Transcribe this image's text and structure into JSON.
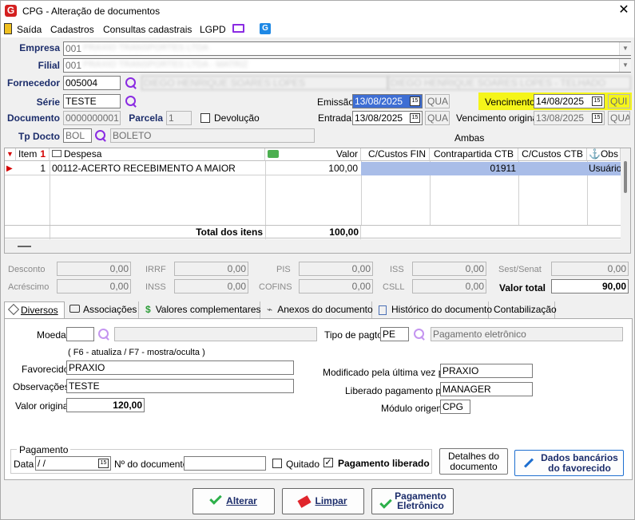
{
  "window": {
    "title": "CPG - Alteração de documentos",
    "app_logo": "G"
  },
  "menu": {
    "items": [
      "Saída",
      "Cadastros",
      "Consultas cadastrais",
      "LGPD"
    ]
  },
  "header": {
    "empresa": {
      "label": "Empresa",
      "code": "001",
      "name": "PRAXIO TRANSPORTES LTDA"
    },
    "filial": {
      "label": "Filial",
      "code": "001",
      "name": "PRAXIO TRANSPORTES LTDA - MATRIZ"
    },
    "fornecedor": {
      "label": "Fornecedor",
      "code": "005004",
      "name": "DIEGO HENRIQUE SOARES LOPES",
      "name2": "DIEGO HENRIQUE SOARES LOPES - TELHADO"
    },
    "serie": {
      "label": "Série",
      "value": "TESTE"
    },
    "emissao": {
      "label": "Emissão",
      "date": "13/08/2025",
      "day": "QUA"
    },
    "vencimento": {
      "label": "Vencimento",
      "date": "14/08/2025",
      "day": "QUI"
    },
    "documento": {
      "label": "Documento",
      "value": "0000000001"
    },
    "parcela": {
      "label": "Parcela",
      "value": "1"
    },
    "devolucao": {
      "label": "Devolução",
      "checked": false
    },
    "entrada": {
      "label": "Entrada",
      "date": "13/08/2025",
      "day": "QUA"
    },
    "venc_original": {
      "label": "Vencimento original",
      "date": "13/08/2025",
      "day": "QUA"
    },
    "tp_docto": {
      "label": "Tp Docto",
      "code": "BOL",
      "name": "BOLETO"
    },
    "ambas": "Ambas"
  },
  "grid": {
    "columns": [
      "Item",
      "Despesa",
      "Valor",
      "C/Custos FIN",
      "Contrapartida CTB",
      "C/Custos CTB",
      "Obs"
    ],
    "rows": [
      {
        "item": "1",
        "despesa": "00112-ACERTO RECEBIMENTO A MAIOR",
        "valor": "100,00",
        "cc_fin": "",
        "contrapartida": "01911",
        "cc_ctb": "",
        "obs": "Usuário"
      }
    ],
    "total_label": "Total dos itens",
    "total_value": "100,00"
  },
  "totals": {
    "desconto": {
      "label": "Desconto",
      "value": "0,00"
    },
    "irrf": {
      "label": "IRRF",
      "value": "0,00"
    },
    "pis": {
      "label": "PIS",
      "value": "0,00"
    },
    "iss": {
      "label": "ISS",
      "value": "0,00"
    },
    "sest": {
      "label": "Sest/Senat",
      "value": "0,00"
    },
    "acrescimo": {
      "label": "Acréscimo",
      "value": "0,00"
    },
    "inss": {
      "label": "INSS",
      "value": "0,00"
    },
    "cofins": {
      "label": "COFINS",
      "value": "0,00"
    },
    "csll": {
      "label": "CSLL",
      "value": "0,00"
    },
    "valor_total": {
      "label": "Valor total",
      "value": "90,00"
    }
  },
  "tabs": [
    "Diversos",
    "Associações",
    "Valores complementares",
    "Anexos do documento",
    "Histórico do documento",
    "Contabilização"
  ],
  "diversos": {
    "moeda": {
      "label": "Moeda",
      "value": ""
    },
    "tipo_pagto": {
      "label": "Tipo de pagto",
      "code": "PE",
      "name": "Pagamento eletrônico"
    },
    "hint": "( F6 - atualiza / F7 - mostra/oculta )",
    "favorecido": {
      "label": "Favorecido",
      "value": "PRAXIO"
    },
    "observacoes": {
      "label": "Observações",
      "value": "TESTE"
    },
    "valor_original": {
      "label": "Valor original",
      "value": "120,00"
    },
    "modificado": {
      "label": "Modificado pela última vez por",
      "value": "PRAXIO"
    },
    "liberado": {
      "label": "Liberado pagamento por",
      "value": "MANAGER"
    },
    "modulo": {
      "label": "Módulo origem",
      "value": "CPG"
    },
    "pagamento": {
      "legend": "Pagamento",
      "data_label": "Data",
      "data_value": " /  /",
      "ndoc_label": "Nº do documento",
      "ndoc_value": "",
      "quitado": "Quitado",
      "liberado": "Pagamento liberado"
    },
    "detalhes_btn": "Detalhes do documento",
    "dados_btn": "Dados bancários do favorecido"
  },
  "footer": {
    "alterar": "Alterar",
    "limpar": "Limpar",
    "pagamento_line1": "Pagamento",
    "pagamento_line2": "Eletrônico"
  }
}
